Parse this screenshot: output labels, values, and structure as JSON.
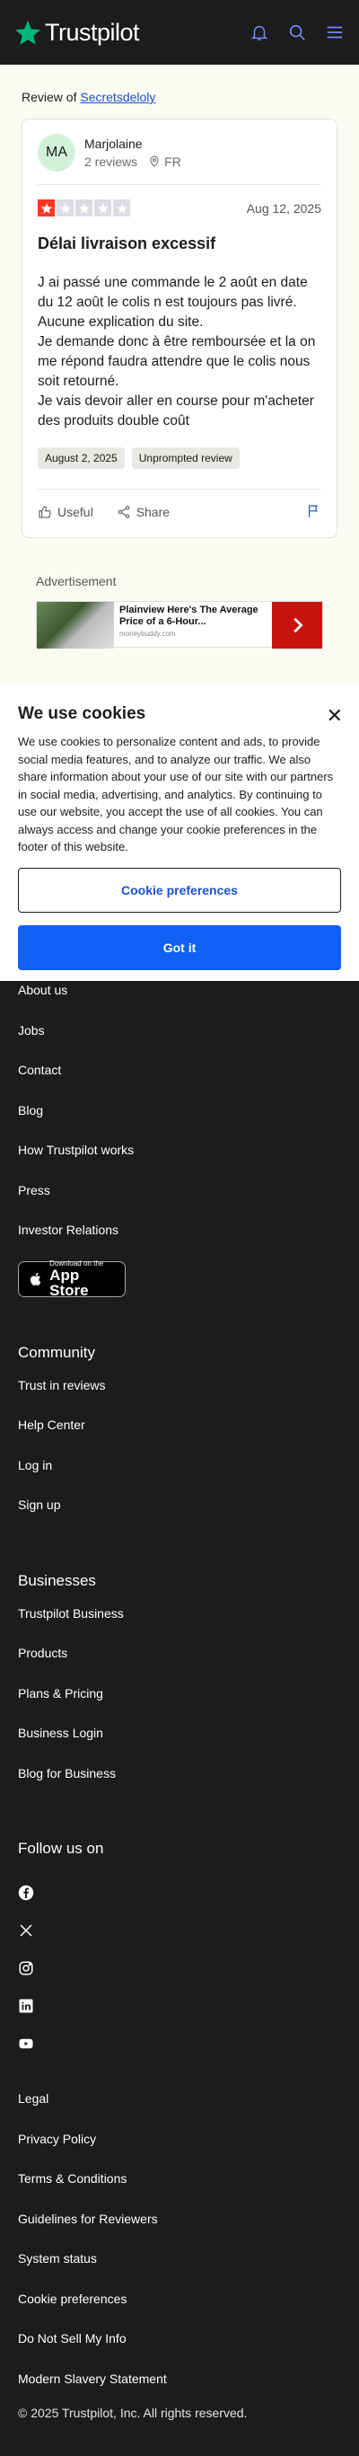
{
  "header": {
    "logo_text": "Trustpilot",
    "brand_color": "#00b67a",
    "icons": [
      "bell-icon",
      "search-icon",
      "menu-icon"
    ]
  },
  "review_of": {
    "prefix": "Review of",
    "company": "Secretsdeloly"
  },
  "review": {
    "avatar_initials": "MA",
    "user_name": "Marjolaine",
    "reviews_count": "2 reviews",
    "country": "FR",
    "rating": 1,
    "rating_max": 5,
    "date": "Aug 12, 2025",
    "title": "Délai livraison excessif",
    "body": [
      "J ai passé une commande le 2 août en date du 12 août le colis n est toujours pas livré.",
      "Aucune explication du site.",
      "Je demande donc à être remboursée et la on me répond faudra attendre que le colis nous soit retourné.",
      "Je vais devoir aller en course pour m'acheter des produits double coût"
    ],
    "tags": [
      "August 2, 2025",
      "Unprompted review"
    ],
    "useful_label": "Useful",
    "share_label": "Share",
    "star_color": "#ff3722"
  },
  "advertisement": {
    "label": "Advertisement",
    "title": "Plainview Here's The Average Price of a 6-Hour...",
    "source": "moneybuddy.com"
  },
  "cookie_banner": {
    "title": "We use cookies",
    "text": "We use cookies to personalize content and ads, to provide social media features, and to analyze our traffic. We also share information about your use of our site with our partners in social media, advertising, and analytics. By continuing to use our website, you accept the use of all cookies. You can always access and change your cookie preferences in the footer of this website.",
    "preferences_label": "Cookie preferences",
    "accept_label": "Got it",
    "accent_color": "#1060f5"
  },
  "footer": {
    "about_links": [
      "About us",
      "Jobs",
      "Contact",
      "Blog",
      "How Trustpilot works",
      "Press",
      "Investor Relations"
    ],
    "app_store": {
      "small": "Download on the",
      "big": "App Store"
    },
    "community_heading": "Community",
    "community_links": [
      "Trust in reviews",
      "Help Center",
      "Log in",
      "Sign up"
    ],
    "business_heading": "Businesses",
    "business_links": [
      "Trustpilot Business",
      "Products",
      "Plans & Pricing",
      "Business Login",
      "Blog for Business"
    ],
    "follow_heading": "Follow us on",
    "socials": [
      "facebook-icon",
      "x-icon",
      "instagram-icon",
      "linkedin-icon",
      "youtube-icon"
    ],
    "legal_links": [
      "Legal",
      "Privacy Policy",
      "Terms & Conditions",
      "Guidelines for Reviewers",
      "System status",
      "Cookie preferences",
      "Do Not Sell My Info",
      "Modern Slavery Statement"
    ],
    "copyright": "© 2025 Trustpilot, Inc. All rights reserved."
  }
}
